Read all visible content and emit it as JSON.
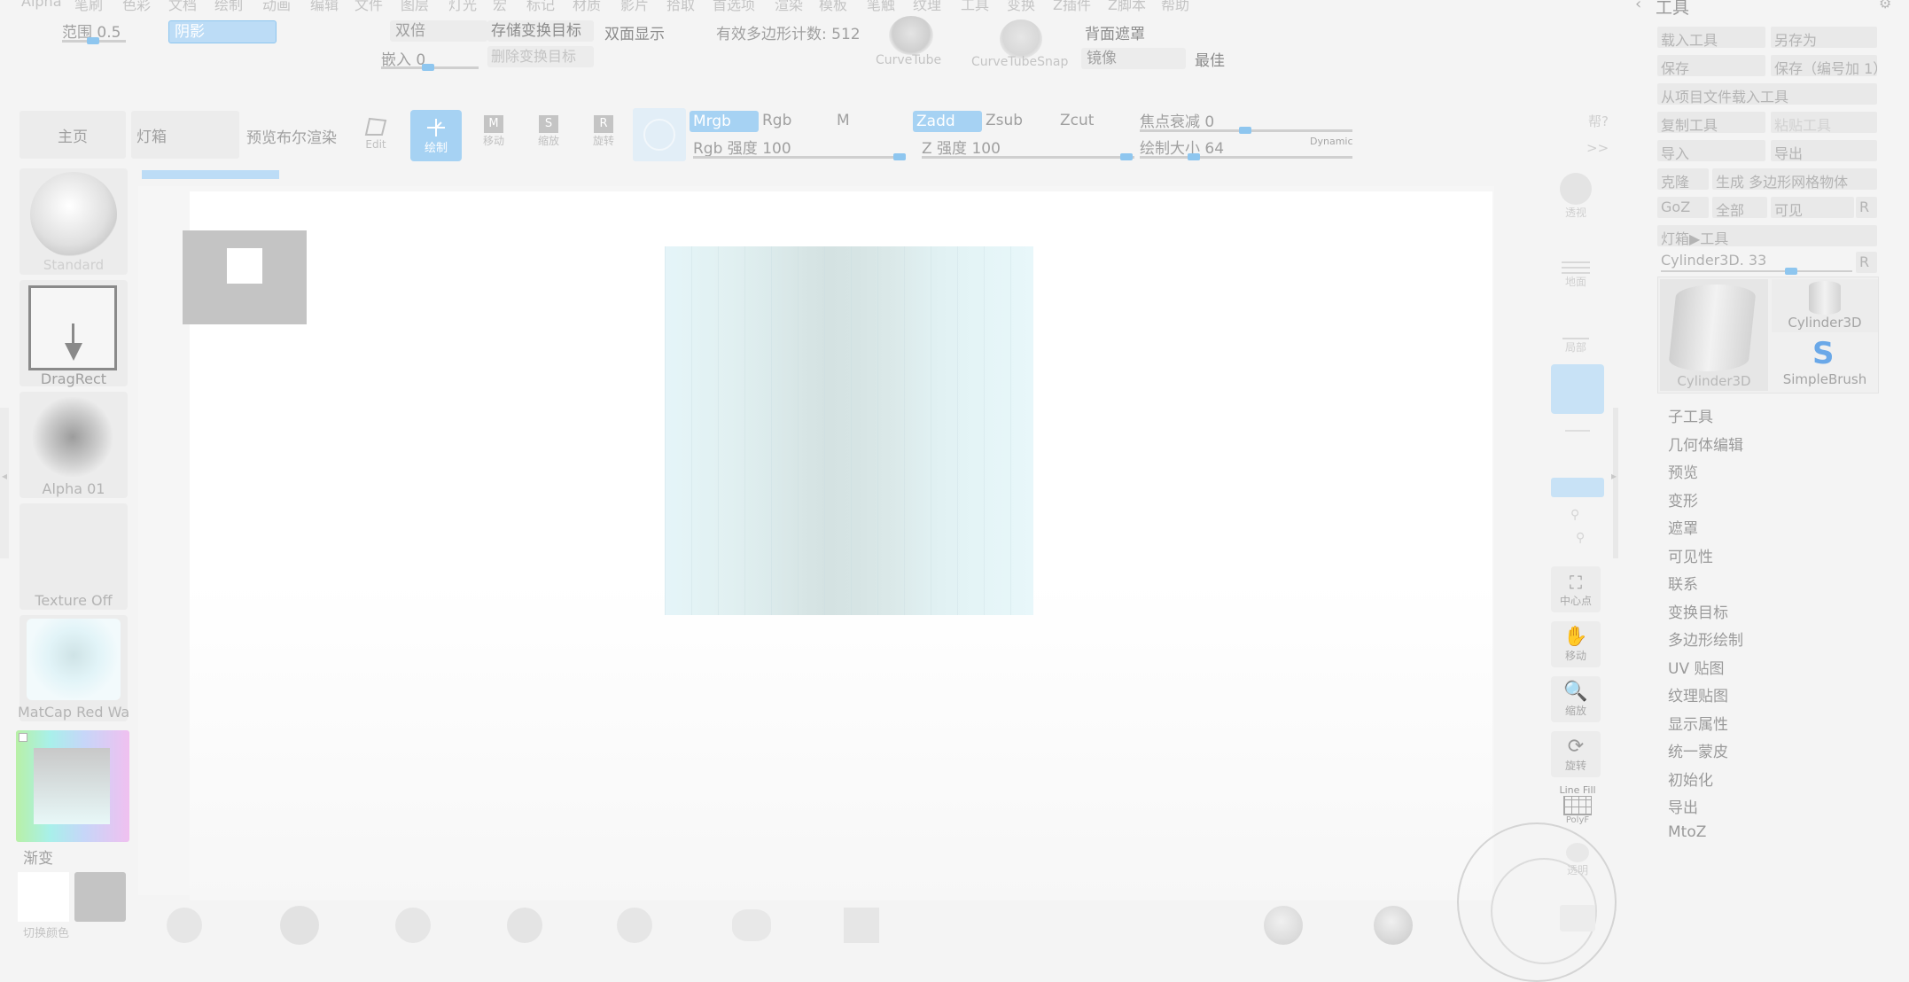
{
  "menu_bar": [
    "Alpha",
    "笔刷",
    "色彩",
    "文档",
    "绘制",
    "动画",
    "编辑",
    "文件",
    "图层",
    "灯光",
    "宏",
    "标记",
    "材质",
    "影片",
    "拾取",
    "首选项",
    "渲染",
    "模板",
    "笔触",
    "纹理",
    "工具",
    "变换",
    "Z插件",
    "Z脚本",
    "帮助"
  ],
  "tool_panel_title": "工具",
  "top_strip": {
    "range_label": "范围 0.5",
    "shadow_label": "阴影",
    "double_label": "双倍",
    "store_morph_label": "存储变换目标",
    "double_display_label": "双面显示",
    "poly_count_label": "有效多边形计数: 512",
    "embed_label": "嵌入 0",
    "delete_morph_label": "删除变换目标",
    "curvetube_label": "CurveTube",
    "curvetubesnap_label": "CurveTubeSnap",
    "backface_mask_label": "背面遮罩",
    "mirror_label": "镜像",
    "best_label": "最佳"
  },
  "toolbar": {
    "home_tab": "主页",
    "lightbox_tab": "灯箱",
    "preview_bool": "预览布尔渲染",
    "edit_label": "Edit",
    "draw_label": "绘制",
    "move_label": "移动",
    "scale_label": "缩放",
    "rotate_label": "旋转",
    "mrgb": "Mrgb",
    "rgb": "Rgb",
    "m": "M",
    "rgb_intensity": "Rgb 强度 100",
    "zadd": "Zadd",
    "zsub": "Zsub",
    "zcut": "Zcut",
    "z_intensity": "Z 强度 100",
    "focal_shift": "焦点衰减 0",
    "draw_size": "绘制大小 64",
    "dynamic": "Dynamic"
  },
  "left_shelf": {
    "brush_label": "Standard",
    "stroke_label": "DragRect",
    "alpha_label": "Alpha 01",
    "texture_label": "Texture Off",
    "material_label": "MatCap Red Wa",
    "gradient_label": "渐变",
    "switch_label": "切换颜色"
  },
  "right_shelf": {
    "persp_label": "透视",
    "floor_label": "地面",
    "local_label": "局部",
    "frame_label": "中心点",
    "move_label": "移动",
    "zoom_label": "缩放",
    "rotate_label": "旋转",
    "linefill_label": "Line Fill",
    "polyf_label": "PolyF",
    "transp_label": "透明"
  },
  "tool_panel": {
    "load_tool": "载入工具",
    "save_as": "另存为",
    "save": "保存",
    "save_inc": "保存（编号加 1）",
    "load_from_project": "从项目文件载入工具",
    "copy_tool": "复制工具",
    "paste_tool": "粘贴工具",
    "import": "导入",
    "export": "导出",
    "clone": "克隆",
    "make_polymesh": "生成 多边形网格物体",
    "goz": "GoZ",
    "all": "全部",
    "visible": "可见",
    "r1": "R",
    "lightbox_tool": "灯箱▶工具",
    "current_tool": "Cylinder3D. 33",
    "r2": "R",
    "thumb_main": "Cylinder3D",
    "thumb_small1": "Cylinder3D",
    "thumb_small2": "SimpleBrush",
    "sections": [
      "子工具",
      "几何体编辑",
      "预览",
      "变形",
      "遮罩",
      "可见性",
      "联系",
      "变换目标",
      "多边形绘制",
      "UV 贴图",
      "纹理贴图",
      "显示属性",
      "统一蒙皮",
      "初始化",
      "导出",
      "MtoZ"
    ]
  },
  "colors": {
    "accent": "#8ec6ef",
    "highlight_button": "#bcdcf6",
    "canvas_bg": "#ffffff",
    "cylinder_tint": "#e4f3f6"
  }
}
